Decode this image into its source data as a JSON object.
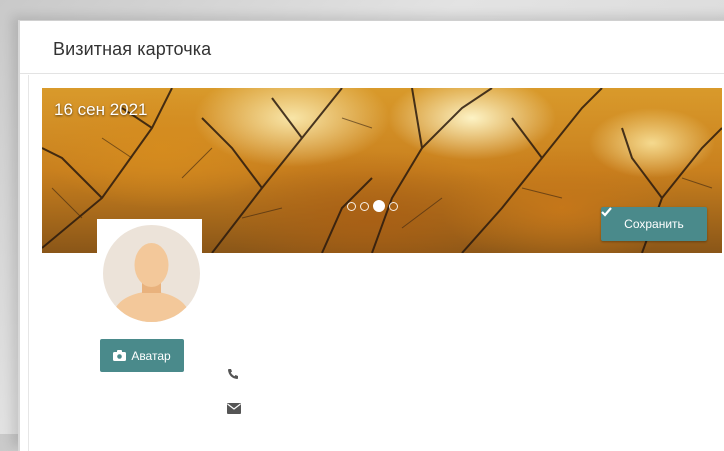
{
  "card": {
    "title": "Визитная карточка",
    "cover_date": "16 сен 2021",
    "save_label": "Сохранить",
    "avatar_label": "Аватар",
    "carousel": {
      "count": 4,
      "active_index": 2
    }
  },
  "icons": {
    "save": "check-icon",
    "avatar": "camera-icon",
    "phone": "phone-icon",
    "email": "envelope-icon"
  },
  "colors": {
    "accent": "#4a8a8b",
    "title_text": "#333333"
  }
}
